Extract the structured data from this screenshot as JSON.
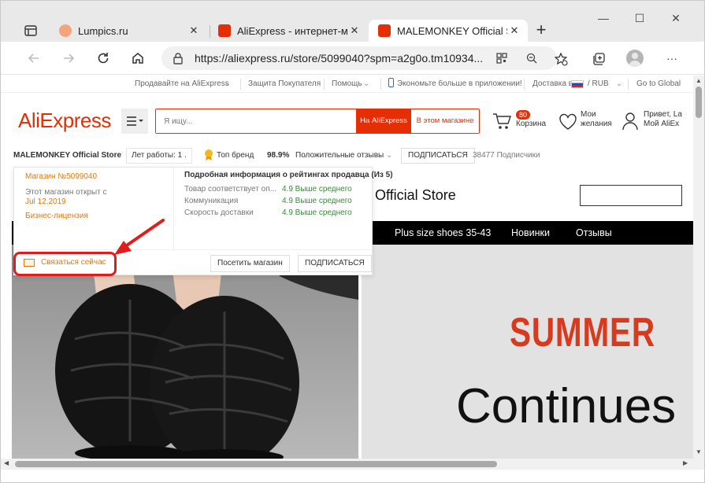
{
  "browser": {
    "tabs": [
      {
        "title": "Lumpics.ru",
        "favicon_color": "#f2a57c",
        "active": false
      },
      {
        "title": "AliExpress - интернет-ма",
        "favicon_color": "#e62e04",
        "active": false
      },
      {
        "title": "MALEMONKEY Official Sto",
        "favicon_color": "#e62e04",
        "active": true
      }
    ],
    "close_glyph": "✕",
    "new_tab_glyph": "+",
    "window_controls": {
      "minimize": "—",
      "maximize": "☐",
      "close": "✕"
    },
    "url": "https://aliexpress.ru/store/5099040?spm=a2g0o.tm10934...",
    "nav_icons": [
      "back-icon",
      "forward-icon",
      "refresh-icon",
      "home-icon"
    ],
    "toolbar_icons": [
      "lock-icon",
      "qr-icon",
      "zoom-icon",
      "favorite-add-icon",
      "collections-icon",
      "profile-icon",
      "more-icon"
    ],
    "more_glyph": "···"
  },
  "ali": {
    "topbar": {
      "sell": "Продавайте на AliExpress",
      "protection": "Защита Покупателя",
      "help": "Помощь",
      "app": "Экономьте больше в приложении!",
      "ship_to": "Доставка в",
      "currency": "/ RUB",
      "global": "Go to Global"
    },
    "logo": "AliExpress",
    "search": {
      "placeholder": "Я ищу...",
      "btn_all": "На AliExpress",
      "btn_store": "В этом магазине"
    },
    "cart": {
      "label": "Корзина",
      "count": "80"
    },
    "wishlist": {
      "line1": "Мои",
      "line2": "желания"
    },
    "account": {
      "line1": "Привет, La",
      "line2": "Мой AliEx"
    },
    "accent_color": "#e62e04"
  },
  "store": {
    "name": "MALEMONKEY Official Store",
    "years_open": "Лет работы: 1 .",
    "top_brand": "Топ бренд",
    "rating": "98.9%",
    "feedback": "Положительные отзывы",
    "subscribe": "ПОДПИСАТЬСЯ",
    "followers": "38477 Подписчики",
    "banner_title": "Official Store",
    "nav": [
      "Plus size shoes 35-43",
      "Новинки",
      "Отзывы"
    ],
    "promo_line1": "SUMMER",
    "promo_line2": "Continues"
  },
  "popup": {
    "store_number": "Магазин №5099040",
    "opened_since": "Этот магазин открыт с",
    "opened_date": "Jul 12,2019",
    "license": "Бизнес-лицензия",
    "ratings_title": "Подробная информация о рейтингах продавца (Из 5)",
    "ratings": [
      {
        "label": "Товар соответствует оп...",
        "value": "4.9 Выше среднего"
      },
      {
        "label": "Коммуникация",
        "value": "4.9 Выше среднего"
      },
      {
        "label": "Скорость доставки",
        "value": "4.9 Выше среднего"
      }
    ],
    "contact": "Связаться сейчас",
    "visit": "Посетить магазин",
    "subscribe": "ПОДПИСАТЬСЯ"
  },
  "annotation_color": "#e31b1b"
}
